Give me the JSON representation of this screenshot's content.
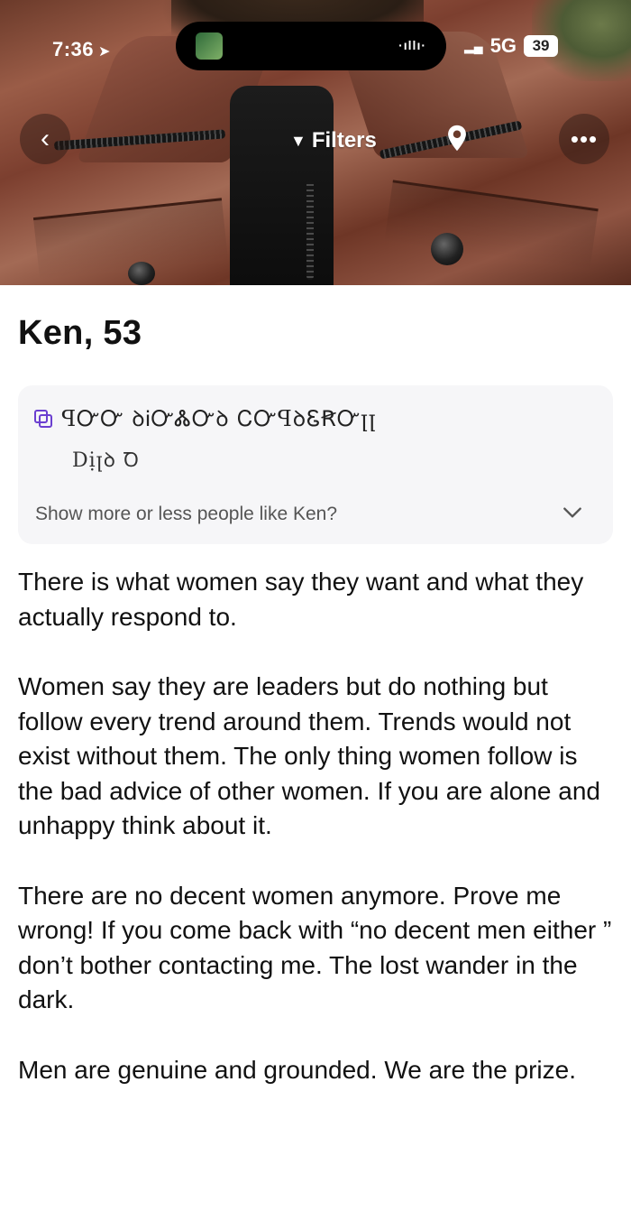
{
  "status_bar": {
    "time": "7:36",
    "network": "5G",
    "battery": "39"
  },
  "nav": {
    "filters_label": "Filters",
    "back_icon": "chevron-left-icon",
    "more_icon": "more-dots-icon",
    "location_icon": "location-pin-icon"
  },
  "profile": {
    "name_age": "Ken, 53",
    "prompt": {
      "line1": "ꟼᏅᏅ ꝺᎥᏅᏜᏅꝺ ᏟᏅꟼꝺᏋꞦᏅꞁꞁ",
      "line2": "Dịꞁꝺ Ꝺ",
      "show_more_label": "Show more or less people like Ken?"
    },
    "bio": [
      "There is what women say they want and what they actually respond to.",
      "Women say they are leaders but do nothing but follow every trend around them. Trends would not exist without them. The only thing women follow is the bad advice of other women. If you are alone and unhappy think about it.",
      "There are no decent women anymore. Prove me wrong! If you come back with “no decent men either ” don’t bother contacting me. The lost wander in the dark.",
      "Men are genuine and grounded. We are the prize."
    ]
  },
  "colors": {
    "card_bg": "#f6f6f8",
    "text": "#111111",
    "muted": "#555555"
  }
}
